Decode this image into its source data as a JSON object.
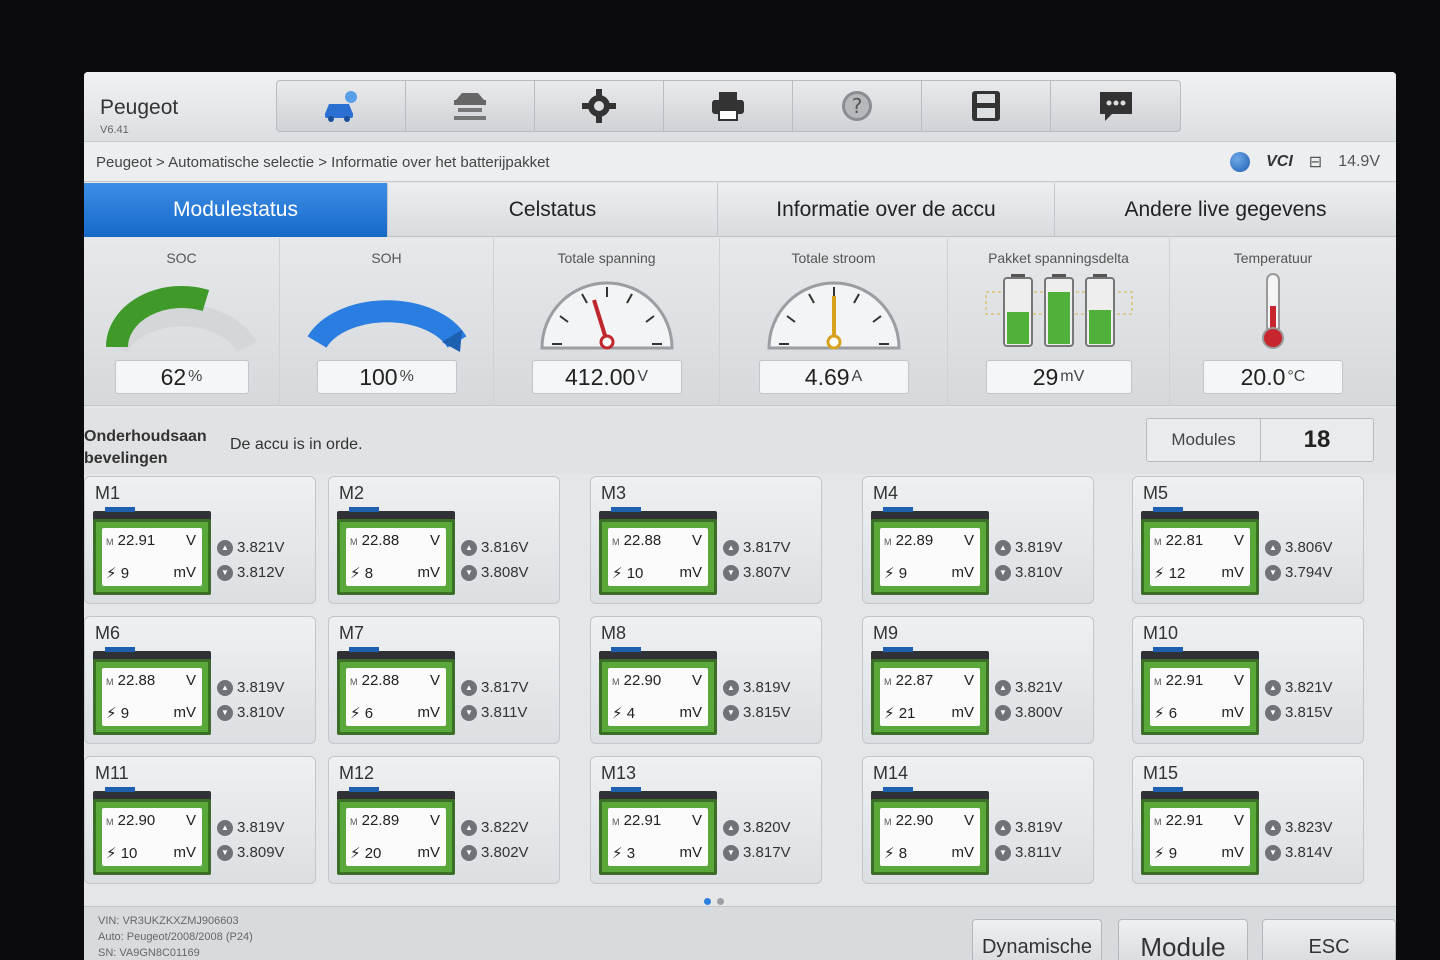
{
  "brand": {
    "name": "Peugeot",
    "version": "V6.41"
  },
  "toolbar": [
    {
      "name": "vehicle-diagnose-icon"
    },
    {
      "name": "car-lift-icon"
    },
    {
      "name": "gear-icon"
    },
    {
      "name": "printer-icon"
    },
    {
      "name": "help-icon"
    },
    {
      "name": "save-icon"
    },
    {
      "name": "message-icon"
    }
  ],
  "breadcrumb": "Peugeot > Automatische selectie > Informatie over het batterijpakket",
  "status": {
    "vci": "VCI",
    "voltage": "14.9V"
  },
  "tabs": [
    {
      "label": "Modulestatus",
      "active": true
    },
    {
      "label": "Celstatus",
      "active": false
    },
    {
      "label": "Informatie over de accu",
      "active": false
    },
    {
      "label": "Andere live gegevens",
      "active": false
    }
  ],
  "gauges": [
    {
      "label": "SOC",
      "value": "62",
      "unit": "%",
      "fraction": 0.62,
      "color": "#3f9a2a"
    },
    {
      "label": "SOH",
      "value": "100",
      "unit": "%",
      "fraction": 1.0,
      "color": "#2a7de1"
    },
    {
      "label": "Totale spanning",
      "value": "412.00",
      "unit": "V"
    },
    {
      "label": "Totale stroom",
      "value": "4.69",
      "unit": "A"
    },
    {
      "label": "Pakket spanningsdelta",
      "value": "29",
      "unit": "mV"
    },
    {
      "label": "Temperatuur",
      "value": "20.0",
      "unit": "°C"
    }
  ],
  "maintenance": {
    "label_line1": "Onderhoudsaan",
    "label_line2": "bevelingen",
    "text": "De accu is in orde.",
    "modules_label": "Modules",
    "modules_count": "18"
  },
  "units": {
    "v": "V",
    "mv": "mV",
    "vsub": "M"
  },
  "modules": [
    {
      "id": "M1",
      "voltage": "22.91",
      "delta": "9",
      "max": "3.821V",
      "min": "3.812V"
    },
    {
      "id": "M2",
      "voltage": "22.88",
      "delta": "8",
      "max": "3.816V",
      "min": "3.808V"
    },
    {
      "id": "M3",
      "voltage": "22.88",
      "delta": "10",
      "max": "3.817V",
      "min": "3.807V"
    },
    {
      "id": "M4",
      "voltage": "22.89",
      "delta": "9",
      "max": "3.819V",
      "min": "3.810V"
    },
    {
      "id": "M5",
      "voltage": "22.81",
      "delta": "12",
      "max": "3.806V",
      "min": "3.794V"
    },
    {
      "id": "M6",
      "voltage": "22.88",
      "delta": "9",
      "max": "3.819V",
      "min": "3.810V"
    },
    {
      "id": "M7",
      "voltage": "22.88",
      "delta": "6",
      "max": "3.817V",
      "min": "3.811V"
    },
    {
      "id": "M8",
      "voltage": "22.90",
      "delta": "4",
      "max": "3.819V",
      "min": "3.815V"
    },
    {
      "id": "M9",
      "voltage": "22.87",
      "delta": "21",
      "max": "3.821V",
      "min": "3.800V"
    },
    {
      "id": "M10",
      "voltage": "22.91",
      "delta": "6",
      "max": "3.821V",
      "min": "3.815V"
    },
    {
      "id": "M11",
      "voltage": "22.90",
      "delta": "10",
      "max": "3.819V",
      "min": "3.809V"
    },
    {
      "id": "M12",
      "voltage": "22.89",
      "delta": "20",
      "max": "3.822V",
      "min": "3.802V"
    },
    {
      "id": "M13",
      "voltage": "22.91",
      "delta": "3",
      "max": "3.820V",
      "min": "3.817V"
    },
    {
      "id": "M14",
      "voltage": "22.90",
      "delta": "8",
      "max": "3.819V",
      "min": "3.811V"
    },
    {
      "id": "M15",
      "voltage": "22.91",
      "delta": "9",
      "max": "3.823V",
      "min": "3.814V"
    }
  ],
  "footer": {
    "vin": "VIN: VR3UKZKXZMJ906603",
    "auto": "Auto: Peugeot/2008/2008 (P24)",
    "sn": "SN: VA9GN8C01169",
    "buttons": [
      "Dynamische",
      "Module",
      "ESC"
    ]
  }
}
